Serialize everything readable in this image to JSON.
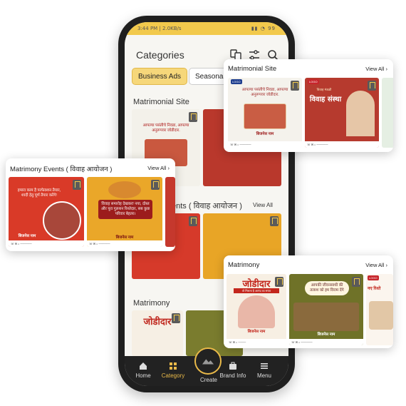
{
  "status_bar": {
    "time": "3:44 PM | 2.0KB/s",
    "icons": "▮▮ ◔ 99"
  },
  "app_bar": {
    "title": "Categories"
  },
  "chips": [
    {
      "label": "Business Ads",
      "active": true
    },
    {
      "label": "Seasonal B",
      "active": false
    }
  ],
  "sections": {
    "matrimonial_site": "Matrimonial Site",
    "events_partial": "ents ( विवाह आयोजन )",
    "matrimony": "Matrimony",
    "view_all": "View All"
  },
  "bottom_nav": [
    {
      "label": "Home",
      "icon": "home-icon",
      "active": false
    },
    {
      "label": "Category",
      "icon": "category-icon",
      "active": true
    },
    {
      "label": "Create",
      "icon": "create-icon",
      "active": false
    },
    {
      "label": "Brand Info",
      "icon": "brand-icon",
      "active": false
    },
    {
      "label": "Menu",
      "icon": "menu-icon",
      "active": false
    }
  ],
  "popouts": {
    "matrimonial": {
      "title": "Matrimonial Site",
      "view_all": "View All",
      "poster1_text": "आपल्या पसंतीचे निवडा, आपल्या अनुरूपवर जोडीदार.",
      "poster1_name": "बिजनेस नाम",
      "poster2_text": "विवाह संस्था",
      "poster2_sub": "विवाह मंडळी",
      "logo": "LOGO"
    },
    "events": {
      "title": "Matrimony Events ( विवाह आयोजन )",
      "view_all": "View All",
      "poster1_text": "हमारा काम है परफेक्शन तैयार, शादी हेतु पूर्ण तैयार करेंगे!",
      "poster1_name": "बिजनेस नाम",
      "poster2_text": "विवाह समारोह देखकर! नया, दोस्त और पूरा गुलशन रिश्तेदार, सब कुछ परिवार बेहतर।",
      "poster2_name": "बिजनेस नाम"
    },
    "matrimony": {
      "title": "Matrimony",
      "view_all": "View All",
      "poster1_title": "जोडीदार",
      "poster1_sub": "तो मिलता है आनंद का सफर",
      "poster1_name": "बिजनेस नाम",
      "poster2_text": "आपकी जीवनसाथी की तलाश को हम विराम देंगे",
      "poster2_name": "बिजनेस नाम",
      "poster3_text": "नए रिश्ते",
      "logo": "LOGO"
    }
  },
  "colors": {
    "accent": "#f2c94c",
    "nav_bg": "#222222",
    "chip_active": "#f6d77a"
  }
}
